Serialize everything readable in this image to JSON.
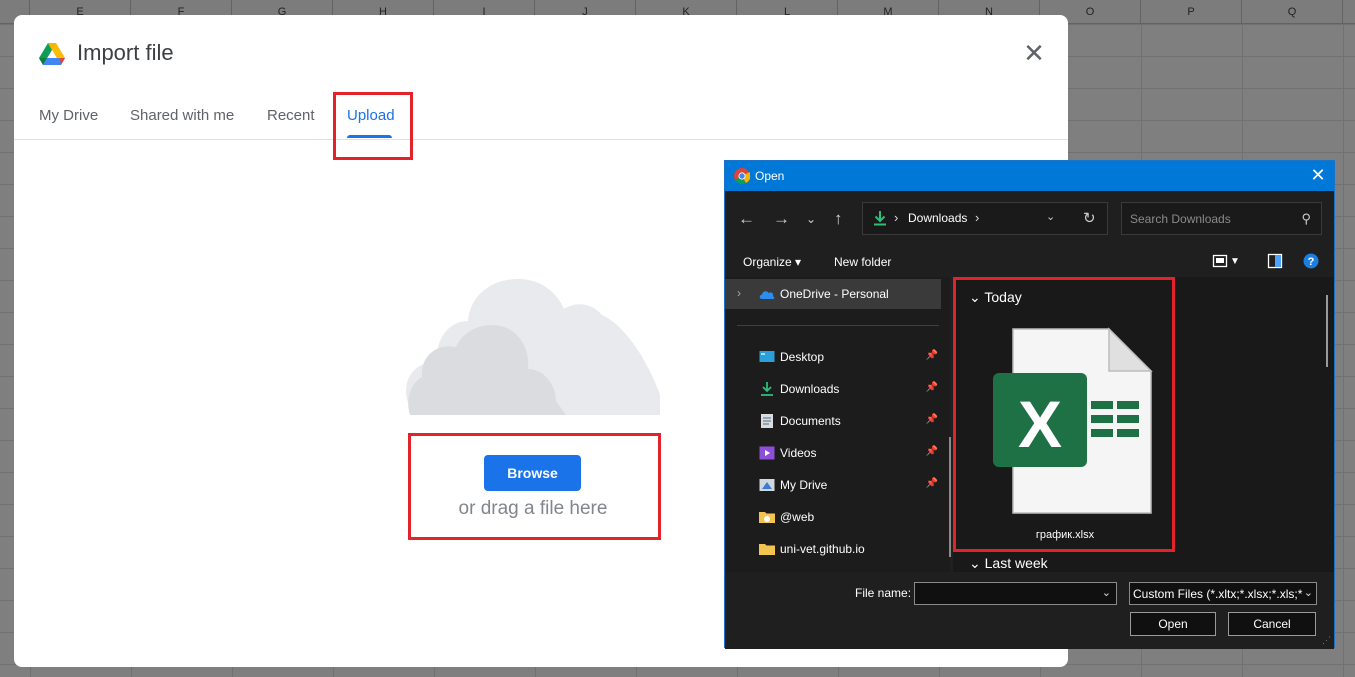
{
  "sheet": {
    "columns": [
      "",
      "E",
      "F",
      "G",
      "H",
      "I",
      "J",
      "K",
      "L",
      "M",
      "N",
      "O",
      "P",
      "Q"
    ]
  },
  "import_dialog": {
    "title": "Import file",
    "close_icon": "close-icon",
    "tabs": [
      {
        "label": "My Drive",
        "active": false
      },
      {
        "label": "Shared with me",
        "active": false
      },
      {
        "label": "Recent",
        "active": false
      },
      {
        "label": "Upload",
        "active": true
      }
    ],
    "browse_label": "Browse",
    "drag_text": "or drag a file here",
    "accent_color": "#1a73e8",
    "highlight_color": "#e2232a"
  },
  "open_dialog": {
    "title": "Open",
    "address": {
      "current_folder": "Downloads"
    },
    "search_placeholder": "Search Downloads",
    "toolbar": {
      "organize_label": "Organize",
      "new_folder_label": "New folder"
    },
    "nav_items": [
      {
        "label": "OneDrive - Personal",
        "icon": "onedrive-icon",
        "pinned": false
      },
      {
        "label": "Desktop",
        "icon": "desktop-icon",
        "pinned": true
      },
      {
        "label": "Downloads",
        "icon": "downloads-icon",
        "pinned": true
      },
      {
        "label": "Documents",
        "icon": "documents-icon",
        "pinned": true
      },
      {
        "label": "Videos",
        "icon": "videos-icon",
        "pinned": true
      },
      {
        "label": "My Drive",
        "icon": "drive-icon",
        "pinned": true
      },
      {
        "label": "@web",
        "icon": "folder-icon",
        "pinned": false
      },
      {
        "label": "uni-vet.github.io",
        "icon": "folder-icon",
        "pinned": false
      }
    ],
    "groups": [
      {
        "label": "Today"
      },
      {
        "label": "Last week"
      }
    ],
    "files": [
      {
        "name": "график.xlsx",
        "icon": "excel-file-icon"
      }
    ],
    "file_name_label": "File name:",
    "file_name_value": "",
    "file_type_value": "Custom Files (*.xltx;*.xlsx;*.xls;*",
    "open_label": "Open",
    "cancel_label": "Cancel"
  }
}
